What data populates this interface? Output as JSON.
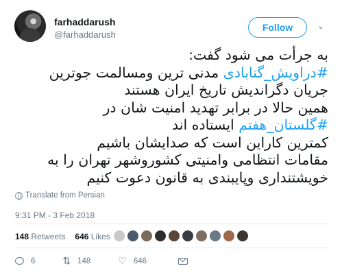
{
  "user": {
    "display_name": "farhaddarush",
    "handle": "@farhaddarush",
    "follow_label": "Follow"
  },
  "tweet": {
    "lines": [
      [
        {
          "t": "به جرأت می شود گفت:",
          "h": false
        }
      ],
      [
        {
          "t": "#دراویش_گنابادی",
          "h": true
        },
        {
          "t": " مدنی ترین ومسالمت جوترین",
          "h": false
        }
      ],
      [
        {
          "t": "جریان دگراندیش تاریخ ایران هستند",
          "h": false
        }
      ],
      [
        {
          "t": "همین حالا در برابر تهدید امنیت شان در",
          "h": false
        }
      ],
      [
        {
          "t": "#گلستان_هفتم",
          "h": true
        },
        {
          "t": " ایستاده اند",
          "h": false
        }
      ],
      [
        {
          "t": "کمترین کاراین است که صدایشان باشیم",
          "h": false
        }
      ],
      [
        {
          "t": "مقامات انتظامی وامنیتی کشوروشهر تهران را به",
          "h": false
        }
      ],
      [
        {
          "t": "خویشتنداری وپایبندی به قانون دعوت کنیم",
          "h": false
        }
      ]
    ],
    "translate_label": "Translate from Persian",
    "timestamp": "9:31 PM - 3 Feb 2018"
  },
  "stats": {
    "retweets_count": "148",
    "retweets_label": "Retweets",
    "likes_count": "646",
    "likes_label": "Likes"
  },
  "likers": [
    "#c9c9c9",
    "#4b5a6a",
    "#7a6a5c",
    "#2e2e2e",
    "#5a4638",
    "#3a3a44",
    "#7d6e62",
    "#6b7a88",
    "#a06a4a",
    "#3d3530"
  ],
  "actions": {
    "reply_count": "6",
    "retweet_count": "148",
    "like_count": "646"
  },
  "colors": {
    "accent": "#1da1f2",
    "muted": "#657786",
    "text": "#14171a"
  }
}
